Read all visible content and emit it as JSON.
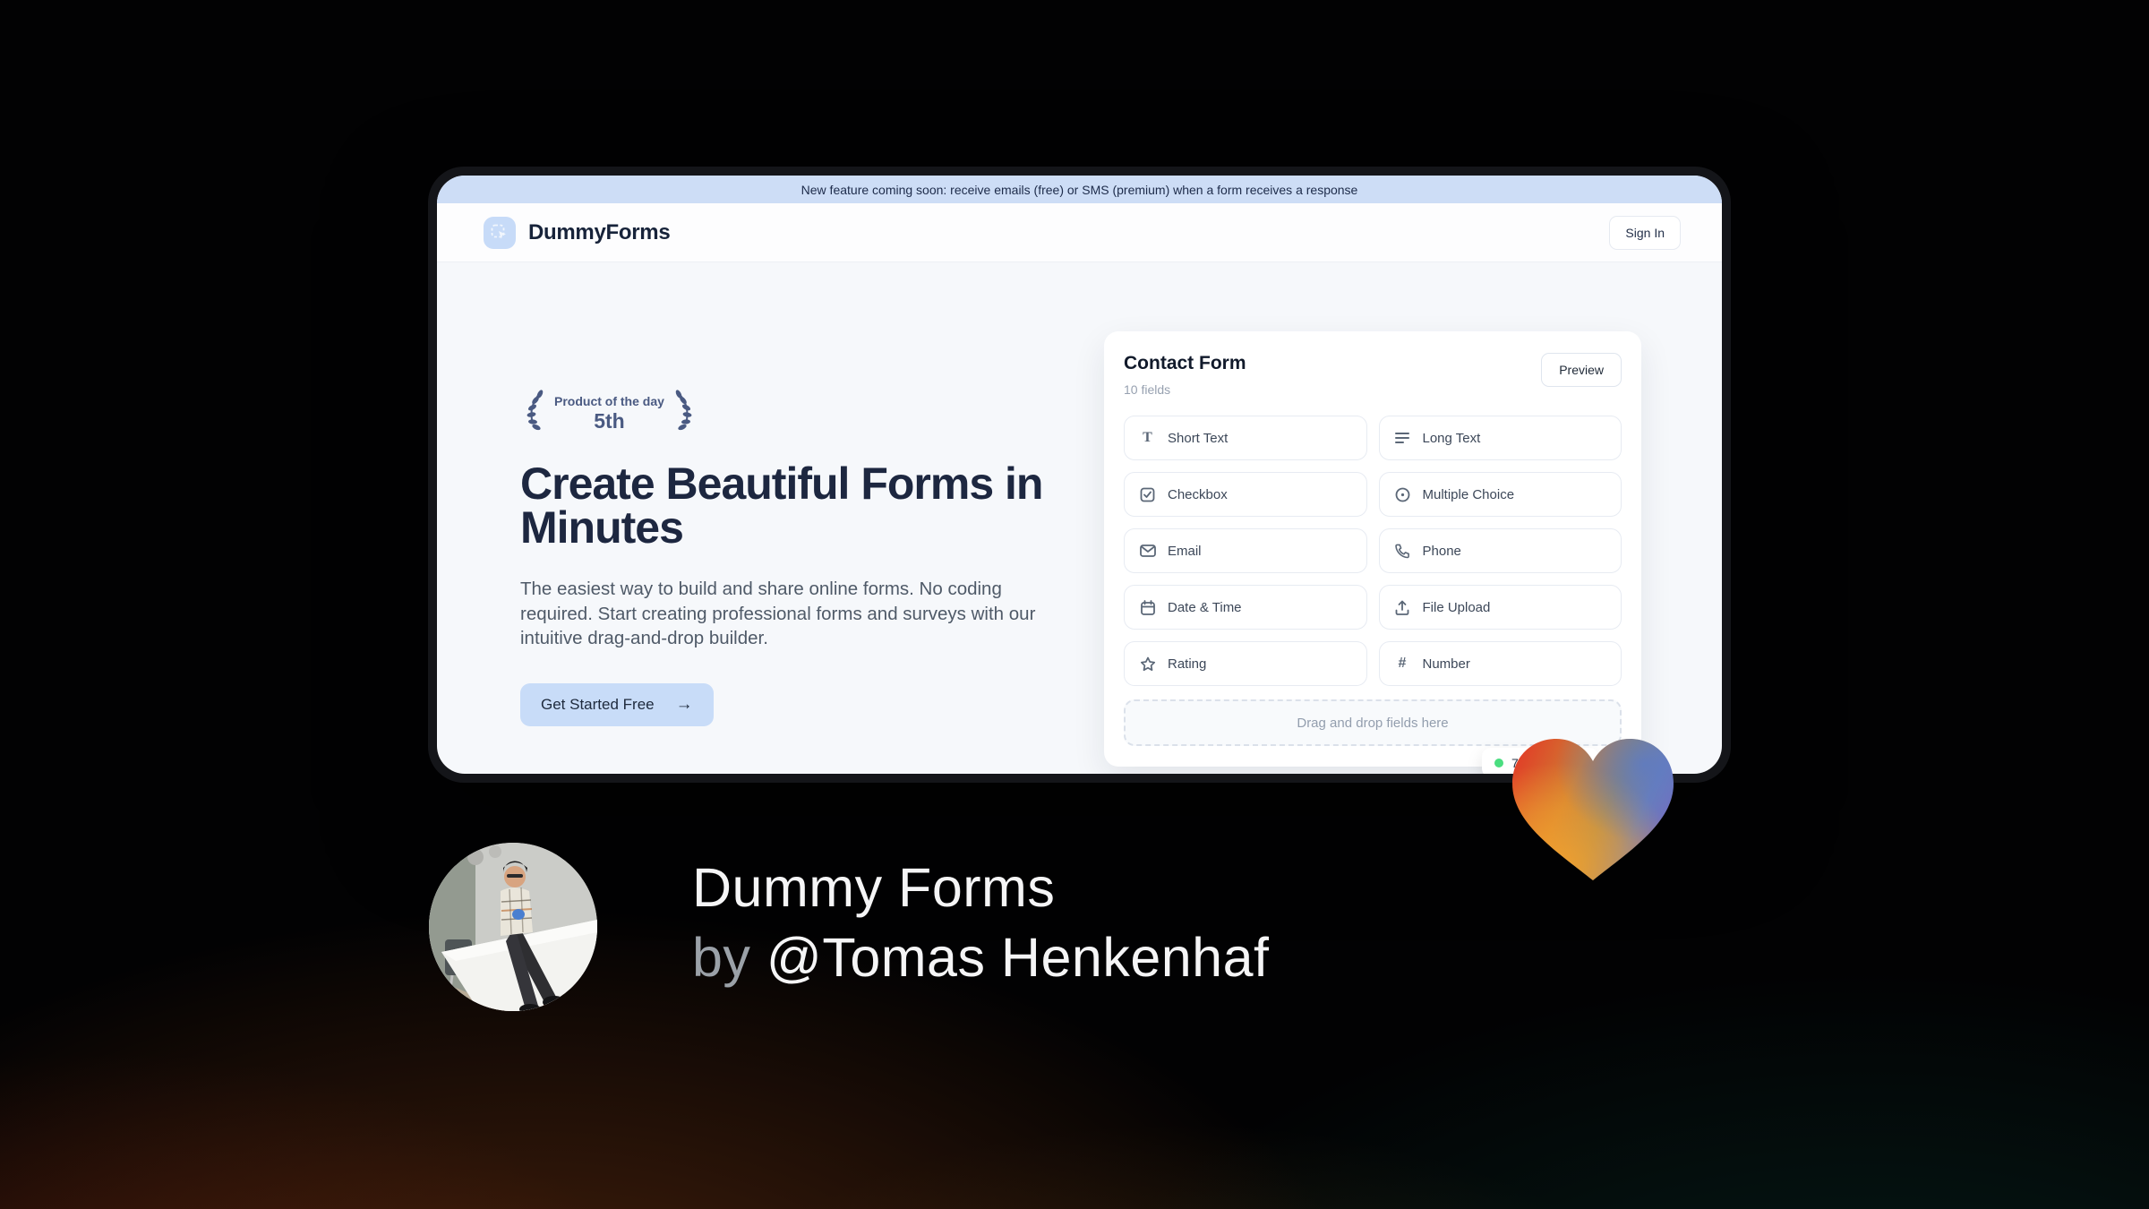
{
  "banner": {
    "text": "New feature coming soon: receive emails (free) or SMS (premium) when a form receives a response"
  },
  "header": {
    "brand": "DummyForms",
    "sign_in_label": "Sign In"
  },
  "hero": {
    "badge": {
      "line1": "Product of the day",
      "line2": "5th"
    },
    "title": "Create Beautiful Forms in Minutes",
    "description": "The easiest way to build and share online forms. No coding required. Start creating professional forms and surveys with our intuitive drag-and-drop builder.",
    "cta_label": "Get Started Free",
    "cta_arrow": "→"
  },
  "form_builder": {
    "title": "Contact Form",
    "subtitle": "10 fields",
    "preview_label": "Preview",
    "fields": [
      {
        "label": "Short Text",
        "icon": "short-text-icon"
      },
      {
        "label": "Long Text",
        "icon": "long-text-icon"
      },
      {
        "label": "Checkbox",
        "icon": "checkbox-icon"
      },
      {
        "label": "Multiple Choice",
        "icon": "multiple-choice-icon"
      },
      {
        "label": "Email",
        "icon": "email-icon"
      },
      {
        "label": "Phone",
        "icon": "phone-icon"
      },
      {
        "label": "Date & Time",
        "icon": "calendar-icon"
      },
      {
        "label": "File Upload",
        "icon": "upload-icon"
      },
      {
        "label": "Rating",
        "icon": "star-icon"
      },
      {
        "label": "Number",
        "icon": "hash-icon"
      }
    ],
    "dropzone_text": "Drag and drop fields here",
    "status_pill": {
      "text": "7",
      "dot_color": "#4ade80"
    }
  },
  "footer": {
    "product_name": "Dummy Forms",
    "byline_prefix": "by",
    "author": "@Tomas Henkenhaf"
  },
  "colors": {
    "banner_bg": "#cdddf6",
    "accent_blue": "#c8dcf8",
    "dark_navy": "#1d2740",
    "laurel": "#4a5a82",
    "status_green": "#4ade80",
    "heart_red": "#e23c27",
    "heart_orange": "#f29f2e",
    "heart_blue": "#5c7bc6",
    "heart_purple": "#7a68c0"
  }
}
